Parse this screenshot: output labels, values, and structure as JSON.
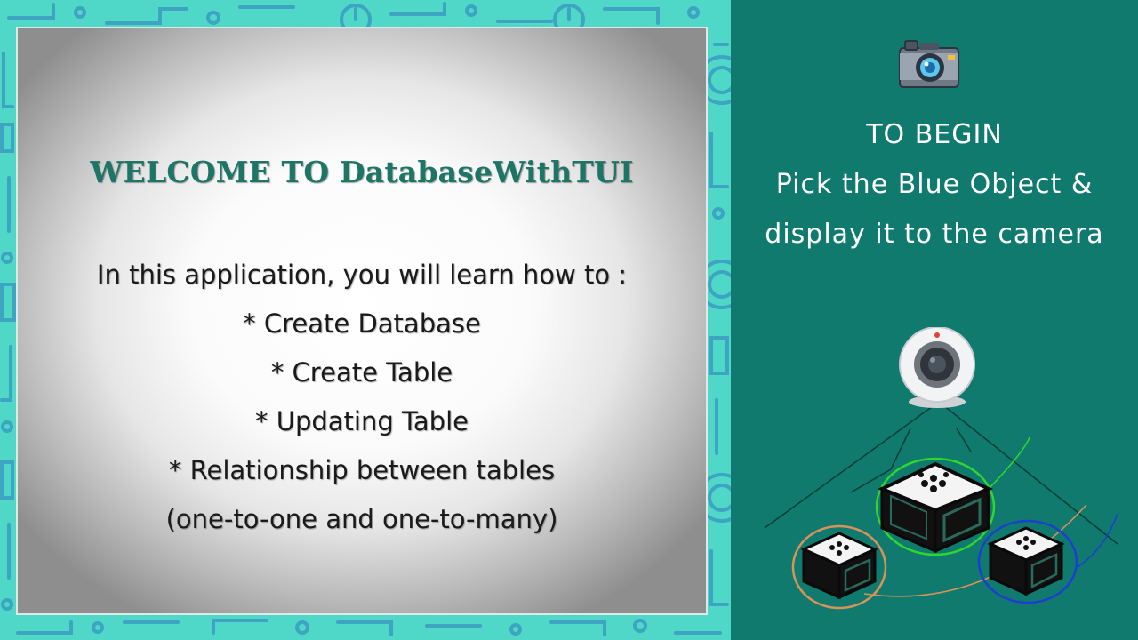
{
  "welcome": {
    "title": "WELCOME TO DatabaseWithTUI",
    "lines": [
      "In this application, you will learn how to :",
      "* Create Database",
      "* Create Table",
      "* Updating Table",
      "* Relationship between tables",
      "(one-to-one and one-to-many)"
    ]
  },
  "instructions": {
    "lines": [
      "TO BEGIN",
      "Pick the Blue Object &",
      "display it to the camera"
    ]
  },
  "icons": {
    "camera": "photo-camera-icon",
    "webcam": "webcam-icon",
    "markers": "fiducial-marker-icon"
  },
  "colors": {
    "panel": "#0f7a6d",
    "pattern_bg": "#4fd8c8",
    "pattern_line": "#3a9bc0",
    "title": "#1d7566",
    "green_ring": "#2fd62f",
    "blue_ring": "#1d3fd0",
    "orange_ring": "#d8925a"
  }
}
